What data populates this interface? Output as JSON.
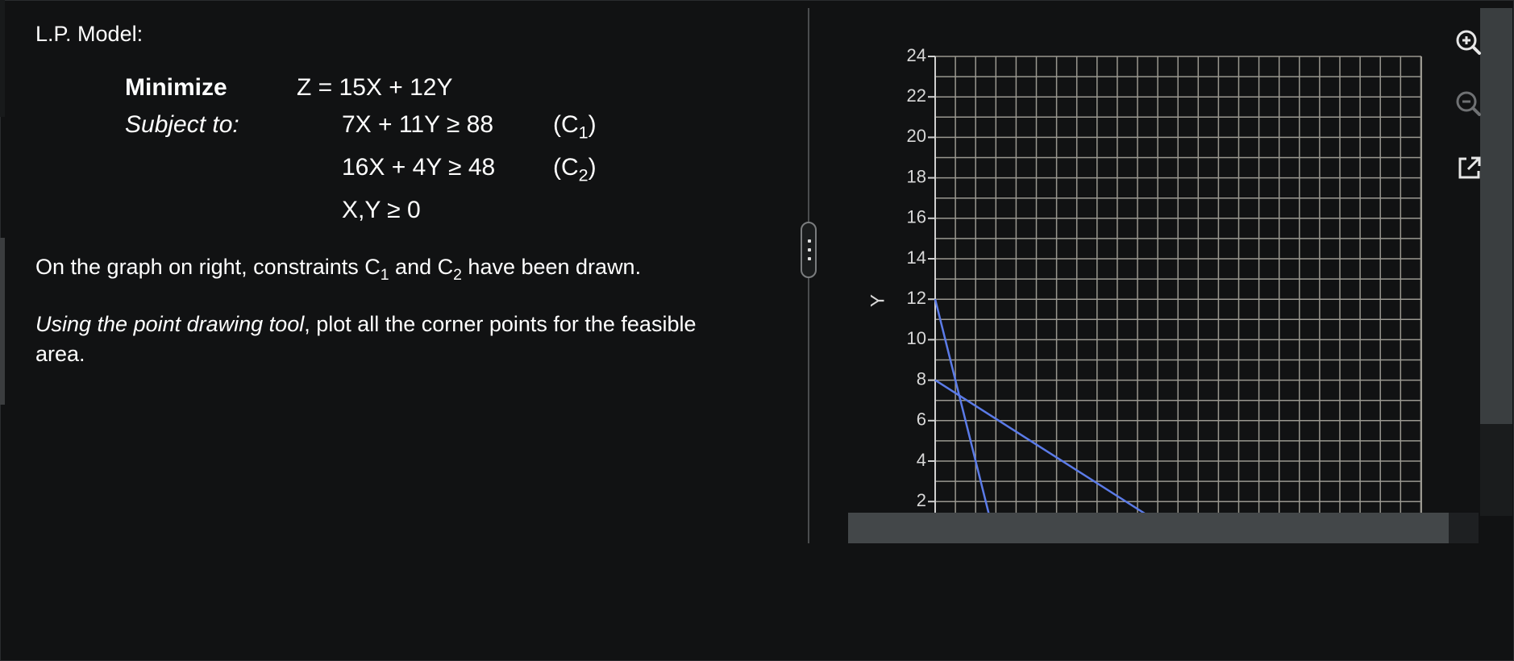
{
  "problem": {
    "heading": "L.P. Model:",
    "objective_label": "Minimize",
    "objective_expr": "Z = 15X + 12Y",
    "subject_to": "Subject to:",
    "constraints": [
      {
        "expr": "7X + 11Y ≥ 88",
        "tag_prefix": "(C",
        "tag_index": "1",
        "tag_suffix": ")"
      },
      {
        "expr": "16X + 4Y ≥ 48",
        "tag_prefix": "(C",
        "tag_index": "2",
        "tag_suffix": ")"
      }
    ],
    "nonneg": "X,Y ≥ 0"
  },
  "instructions": {
    "p1_a": "On the graph on right, constraints C",
    "p1_sub1": "1",
    "p1_b": " and C",
    "p1_sub2": "2",
    "p1_c": " have been drawn.",
    "p2_italic": "Using the point drawing tool",
    "p2_rest": ", plot all the corner points for the feasible",
    "p2_rest2": "area."
  },
  "graph": {
    "y_axis_label": "Y",
    "y_ticks": [
      "24",
      "22",
      "20",
      "18",
      "16",
      "14",
      "12",
      "10",
      "8",
      "6",
      "4",
      "2"
    ],
    "line_color": "#5b7be8",
    "grid_color": "#9a9890",
    "tools": [
      "zoom-in-icon",
      "zoom-out-icon",
      "external-link-icon"
    ]
  },
  "chart_data": {
    "type": "line",
    "ylabel": "Y",
    "ylim": [
      0,
      24
    ],
    "xlim": [
      0,
      24
    ],
    "series": [
      {
        "x": [
          0,
          12.57
        ],
        "y": [
          8,
          0
        ]
      },
      {
        "x": [
          0,
          3
        ],
        "y": [
          12,
          0
        ]
      }
    ]
  }
}
